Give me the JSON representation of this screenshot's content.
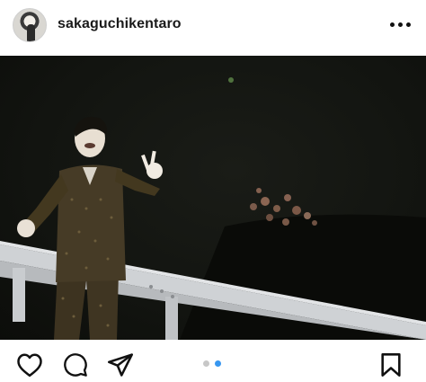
{
  "post": {
    "username": "sakaguchikentaro",
    "more_icon": "more-horizontal-icon",
    "photo_alt": "",
    "carousel": {
      "count": 2,
      "active": 2
    },
    "actions": [
      "heart-icon",
      "comment-icon",
      "share-icon",
      "bookmark-icon"
    ]
  },
  "colors": {
    "text": "#1a1a1a",
    "carousel_active": "#3797f0",
    "carousel_inactive": "#c7c7c7"
  }
}
